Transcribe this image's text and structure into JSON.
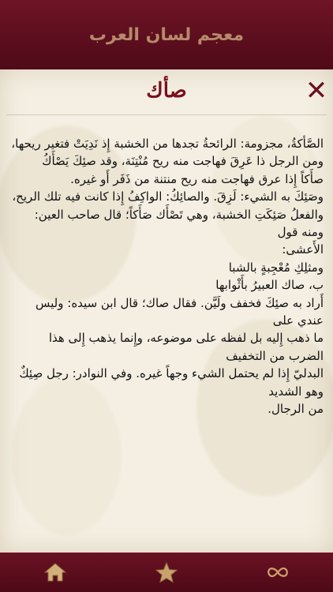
{
  "header": {
    "title": "معجم لسان العرب"
  },
  "entry": {
    "word": "صأك",
    "paragraphs": [
      "الصَّأكةُ، مجزومة: الرائحةُ تجدها من الخشبة إِذ نَدِيَتْ فتغير ريحها، ومن الرجل ذا عَرِقَ فهاجت منه ريح مُنْتِنَة، وقد صئِكَ يَصْأَكُ",
      "صأَكاً إِذا عرق فهاجت منه ريح منتنة من ذَفَر أَو غيره.",
      "وصَئِكَ به الشيء: لَزِقَ. والصائِكُ: الواكِفُ إِذا كانت فيه تلك الريح،",
      "والفعلُ صَئِكَتِ الخشبة، وهي تَصْأَك صَأَكاً؛ قال صاحب العين: ومنه قول",
      "الأَعشى:",
      "ومثلِكِ مُعْجِبةٍ بالشبا",
      "ب، صاك العبيرُ بأَثْوابها",
      "أَراد به صئِكَ فخفف ولَيَّن. فقال صاك؛ قال ابن سيده: وليس عندي على",
      "ما ذهب إِليه بل لفظه على موضوعه، وإِنما يذهب إِلى هذا الضرب من التخفيف",
      "البدليّ إِذا لم يحتمل الشيء وجهاً غيره. وفي النوادر: رجل صِئِكٌ وهو الشديد",
      "من الرجال."
    ]
  },
  "close": {
    "icon": "close-icon",
    "glyph": "✕"
  },
  "tabbar": {
    "items": [
      {
        "icon": "home-icon"
      },
      {
        "icon": "star-icon"
      },
      {
        "icon": "infinity-icon"
      }
    ]
  },
  "colors": {
    "primary": "#5a0d1c",
    "accent": "#7a0f1e",
    "header_text": "#b58a6a",
    "paper": "#f4efe2",
    "icon_gold": "#d3b07a"
  }
}
